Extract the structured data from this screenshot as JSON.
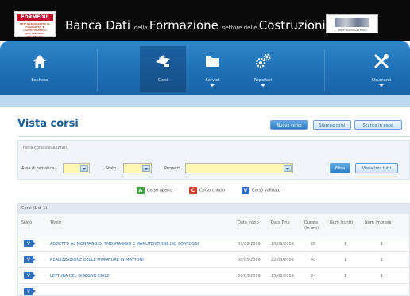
{
  "header": {
    "logo_text": "FORMEDIL",
    "logo_sub": "ENTE NAZIONALE PER LA FORMAZIONE E L'ADDESTRAMENTO PROFESSIONALE NELL'EDILIZIA",
    "title_parts": [
      {
        "text": "Banca ",
        "size": "big"
      },
      {
        "text": "Dati ",
        "size": "big"
      },
      {
        "text": "della ",
        "size": "small"
      },
      {
        "text": "Formazione ",
        "size": "big"
      },
      {
        "text": "settore delle ",
        "size": "small"
      },
      {
        "text": "Costruzioni",
        "size": "big"
      }
    ],
    "sponsor_caption": "ENTE NAZIONALE EDILE"
  },
  "nav": {
    "items": [
      {
        "label": "Bacheca",
        "icon": "home-icon",
        "active": false,
        "dropdown": false
      },
      {
        "label": "Corsi",
        "icon": "courses-icon",
        "active": true,
        "dropdown": false
      },
      {
        "label": "Servizi",
        "icon": "folder-icon",
        "active": false,
        "dropdown": true
      },
      {
        "label": "Reportari",
        "icon": "gears-icon",
        "active": false,
        "dropdown": true
      },
      {
        "label": "Strumenti",
        "icon": "tools-icon",
        "active": false,
        "dropdown": true
      }
    ]
  },
  "page": {
    "title": "Vista corsi",
    "buttons": {
      "new_course": "Nuovo corso",
      "print_courses": "Stampa corsi",
      "export_excel": "Scarica in excel"
    }
  },
  "filters": {
    "heading": "Filtra corsi visualizzati",
    "area_label": "Area di tematica",
    "state_label": "Stato",
    "project_label": "Progetti",
    "filter_button": "Filtra",
    "show_all_button": "Visualizza tutti"
  },
  "legend": [
    {
      "label": "Corso aperto",
      "color": "#3aa53a",
      "glyph": "A"
    },
    {
      "label": "Corso chiuso",
      "color": "#d23b2a",
      "glyph": "C"
    },
    {
      "label": "Corso validato",
      "color": "#2f6fc0",
      "glyph": "V"
    }
  ],
  "table": {
    "caption": "Corsi (1 di 1)",
    "columns": {
      "state": "Stato",
      "title": "Titolo",
      "start": "Data Inizio",
      "end": "Data Fine",
      "duration": "Durata (in ore)",
      "enrolled": "Num Iscritti",
      "companies": "Num Imprese"
    },
    "rows": [
      {
        "state": "V",
        "title": "ADDETTO AL MONTAGGIO, SMONTAGGIO E MANUTENZIONE DEI PONTEGGI",
        "start": "07/09/2009",
        "end": "18/09/2009",
        "duration": "28",
        "enrolled": "1",
        "companies": "1"
      },
      {
        "state": "V",
        "title": "REALIZZAZIONE DELLE MURATURE IN MATTONI",
        "start": "08/05/2009",
        "end": "22/05/2009",
        "duration": "40",
        "enrolled": "1",
        "companies": "1"
      },
      {
        "state": "V",
        "title": "LETTURA DEL DISEGNO EDILE",
        "start": "09/03/2009",
        "end": "13/03/2009",
        "duration": "24",
        "enrolled": "1",
        "companies": "1"
      },
      {
        "state": "V",
        "title": "",
        "start": "",
        "end": "",
        "duration": "",
        "enrolled": "",
        "companies": ""
      }
    ]
  }
}
